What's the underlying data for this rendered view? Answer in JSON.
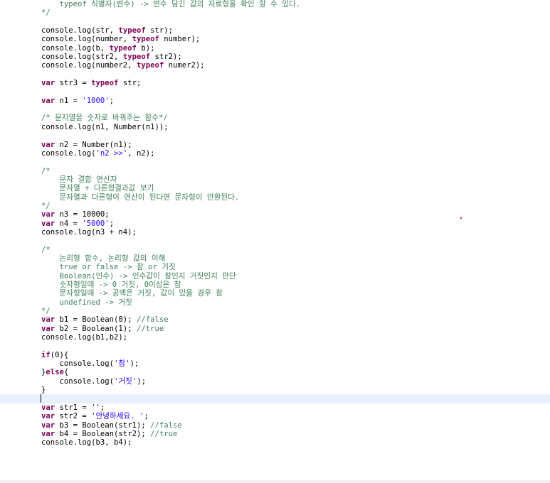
{
  "lines": [
    {
      "t": "cm-block",
      "text": "    typeof 식별자(변수) -> 변수 담긴 값의 자료형을 확인 할 수 있다."
    },
    {
      "t": "cm-block",
      "text": "*/"
    },
    {
      "t": "blank",
      "text": ""
    },
    {
      "t": "code",
      "segs": [
        {
          "c": "",
          "v": "console.log(str, "
        },
        {
          "c": "kw",
          "v": "typeof"
        },
        {
          "c": "",
          "v": " str);"
        }
      ]
    },
    {
      "t": "code",
      "segs": [
        {
          "c": "",
          "v": "console.log(number, "
        },
        {
          "c": "kw",
          "v": "typeof"
        },
        {
          "c": "",
          "v": " number);"
        }
      ]
    },
    {
      "t": "code",
      "segs": [
        {
          "c": "",
          "v": "console.log(b, "
        },
        {
          "c": "kw",
          "v": "typeof"
        },
        {
          "c": "",
          "v": " b);"
        }
      ]
    },
    {
      "t": "code",
      "segs": [
        {
          "c": "",
          "v": "console.log(str2, "
        },
        {
          "c": "kw",
          "v": "typeof"
        },
        {
          "c": "",
          "v": " str2);"
        }
      ]
    },
    {
      "t": "code",
      "segs": [
        {
          "c": "",
          "v": "console.log(number2, "
        },
        {
          "c": "kw",
          "v": "typeof"
        },
        {
          "c": "",
          "v": " numer2);"
        }
      ]
    },
    {
      "t": "blank",
      "text": ""
    },
    {
      "t": "code",
      "segs": [
        {
          "c": "kw",
          "v": "var"
        },
        {
          "c": "",
          "v": " str3 = "
        },
        {
          "c": "kw",
          "v": "typeof"
        },
        {
          "c": "",
          "v": " str;"
        }
      ]
    },
    {
      "t": "blank",
      "text": ""
    },
    {
      "t": "code",
      "segs": [
        {
          "c": "kw",
          "v": "var"
        },
        {
          "c": "",
          "v": " n1 = "
        },
        {
          "c": "str",
          "v": "'1000'"
        },
        {
          "c": "",
          "v": ";"
        }
      ]
    },
    {
      "t": "blank",
      "text": ""
    },
    {
      "t": "cm-block",
      "text": "/* 문자열을 숫자로 바꿔주는 함수*/"
    },
    {
      "t": "code",
      "segs": [
        {
          "c": "",
          "v": "console.log(n1, Number(n1));"
        }
      ]
    },
    {
      "t": "blank",
      "text": ""
    },
    {
      "t": "code",
      "segs": [
        {
          "c": "kw",
          "v": "var"
        },
        {
          "c": "",
          "v": " n2 = Number(n1);"
        }
      ]
    },
    {
      "t": "code",
      "segs": [
        {
          "c": "",
          "v": "console.log("
        },
        {
          "c": "str",
          "v": "'n2 >>'"
        },
        {
          "c": "",
          "v": ", n2);"
        }
      ]
    },
    {
      "t": "blank",
      "text": ""
    },
    {
      "t": "cm-block",
      "text": "/*"
    },
    {
      "t": "cm-block",
      "text": "    문자 결합 연산자"
    },
    {
      "t": "cm-block",
      "text": "    문자열 + 다른형결과값 보기"
    },
    {
      "t": "cm-block",
      "text": "    문자열과 다른형이 연산이 된다면 문자형이 반환된다."
    },
    {
      "t": "cm-block",
      "text": "*/"
    },
    {
      "t": "code",
      "segs": [
        {
          "c": "kw",
          "v": "var"
        },
        {
          "c": "",
          "v": " n3 = 10000;"
        }
      ]
    },
    {
      "t": "code",
      "segs": [
        {
          "c": "kw",
          "v": "var"
        },
        {
          "c": "",
          "v": " n4 = "
        },
        {
          "c": "str",
          "v": "'5000'"
        },
        {
          "c": "",
          "v": ";"
        }
      ]
    },
    {
      "t": "code",
      "segs": [
        {
          "c": "",
          "v": "console.log(n3 + n4);"
        }
      ]
    },
    {
      "t": "blank",
      "text": ""
    },
    {
      "t": "cm-block",
      "text": "/*"
    },
    {
      "t": "cm-block",
      "text": "    논리형 함수, 논리형 값의 이해"
    },
    {
      "t": "cm-block",
      "text": "    true or false -> 참 or 거짓"
    },
    {
      "t": "cm-block",
      "text": "    Boolean(인수) -> 인수값이 참인지 거짓인지 판단"
    },
    {
      "t": "cm-block",
      "text": "    숫자형일때 -> 0 거짓, 0이상은 참"
    },
    {
      "t": "cm-block",
      "text": "    문자형일때 -> 공백은 거짓, 값이 있을 경우 참"
    },
    {
      "t": "cm-block",
      "text": "    undefined -> 거짓"
    },
    {
      "t": "cm-block",
      "text": "*/"
    },
    {
      "t": "code",
      "segs": [
        {
          "c": "kw",
          "v": "var"
        },
        {
          "c": "",
          "v": " b1 = Boolean(0); "
        },
        {
          "c": "cm",
          "v": "//false"
        }
      ]
    },
    {
      "t": "code",
      "segs": [
        {
          "c": "kw",
          "v": "var"
        },
        {
          "c": "",
          "v": " b2 = Boolean(1); "
        },
        {
          "c": "cm",
          "v": "//true"
        }
      ]
    },
    {
      "t": "code",
      "segs": [
        {
          "c": "",
          "v": "console.log(b1,b2);"
        }
      ]
    },
    {
      "t": "blank",
      "text": ""
    },
    {
      "t": "code",
      "segs": [
        {
          "c": "kw",
          "v": "if"
        },
        {
          "c": "",
          "v": "(0){"
        }
      ]
    },
    {
      "t": "code",
      "segs": [
        {
          "c": "",
          "v": "    console.log("
        },
        {
          "c": "str",
          "v": "'참'"
        },
        {
          "c": "",
          "v": ");"
        }
      ]
    },
    {
      "t": "code",
      "segs": [
        {
          "c": "",
          "v": "}"
        },
        {
          "c": "kw",
          "v": "else"
        },
        {
          "c": "",
          "v": "{"
        }
      ]
    },
    {
      "t": "code",
      "segs": [
        {
          "c": "",
          "v": "    console.log("
        },
        {
          "c": "str",
          "v": "'거짓'"
        },
        {
          "c": "",
          "v": ");"
        }
      ]
    },
    {
      "t": "code",
      "segs": [
        {
          "c": "",
          "v": "}"
        }
      ]
    },
    {
      "t": "cur",
      "text": ""
    },
    {
      "t": "code",
      "segs": [
        {
          "c": "kw",
          "v": "var"
        },
        {
          "c": "",
          "v": " str1 = "
        },
        {
          "c": "str",
          "v": "''"
        },
        {
          "c": "",
          "v": ";"
        }
      ]
    },
    {
      "t": "code",
      "segs": [
        {
          "c": "kw",
          "v": "var"
        },
        {
          "c": "",
          "v": " str2 = "
        },
        {
          "c": "str",
          "v": "'안녕하세요. '"
        },
        {
          "c": "",
          "v": ";"
        }
      ]
    },
    {
      "t": "code",
      "segs": [
        {
          "c": "kw",
          "v": "var"
        },
        {
          "c": "",
          "v": " b3 = Boolean(str1); "
        },
        {
          "c": "cm",
          "v": "//false"
        }
      ]
    },
    {
      "t": "code",
      "segs": [
        {
          "c": "kw",
          "v": "var"
        },
        {
          "c": "",
          "v": " b4 = Boolean(str2); "
        },
        {
          "c": "cm",
          "v": "//true"
        }
      ]
    },
    {
      "t": "code",
      "segs": [
        {
          "c": "",
          "v": "console.log(b3, b4);"
        }
      ]
    }
  ]
}
